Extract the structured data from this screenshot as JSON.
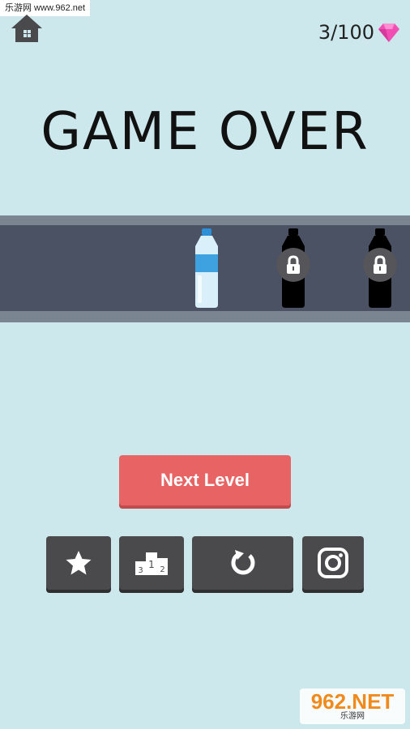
{
  "watermark_top": "乐游网 www.962.net",
  "gems": {
    "count": "3/100",
    "icon": "pink-gem-icon",
    "color": "#f24fb3"
  },
  "title": "GAME OVER",
  "bottles": [
    {
      "state": "selected",
      "icon": "water-bottle-icon"
    },
    {
      "state": "locked",
      "icon": "lock-icon"
    },
    {
      "state": "locked",
      "icon": "lock-icon"
    }
  ],
  "next_level_label": "Next Level",
  "tiles": [
    {
      "icon": "star-icon"
    },
    {
      "icon": "leaderboard-podium-icon",
      "podium_numbers": [
        "3",
        "1",
        "2"
      ]
    },
    {
      "icon": "restart-icon"
    },
    {
      "icon": "instagram-icon"
    }
  ],
  "watermark_bottom": {
    "big": "962.NET",
    "small": "乐游网"
  },
  "colors": {
    "background": "#cde8ec",
    "accent": "#e86464",
    "tile": "#4a4a4c"
  }
}
